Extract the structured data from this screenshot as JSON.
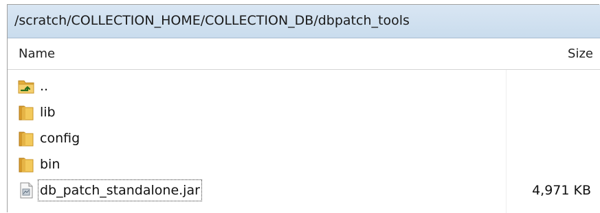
{
  "path_bar": {
    "path": "/scratch/COLLECTION_HOME/COLLECTION_DB/dbpatch_tools"
  },
  "columns": {
    "name": "Name",
    "size": "Size"
  },
  "files": [
    {
      "name": "..",
      "icon": "parent-folder-icon",
      "size": ""
    },
    {
      "name": "lib",
      "icon": "folder-icon",
      "size": ""
    },
    {
      "name": "config",
      "icon": "folder-icon",
      "size": ""
    },
    {
      "name": "bin",
      "icon": "folder-icon",
      "size": ""
    },
    {
      "name": "db_patch_standalone.jar",
      "icon": "jar-file-icon",
      "size": "4,971 KB"
    }
  ],
  "colors": {
    "path_bar_bg": "#c9dced",
    "folder": "#e8b84a"
  }
}
